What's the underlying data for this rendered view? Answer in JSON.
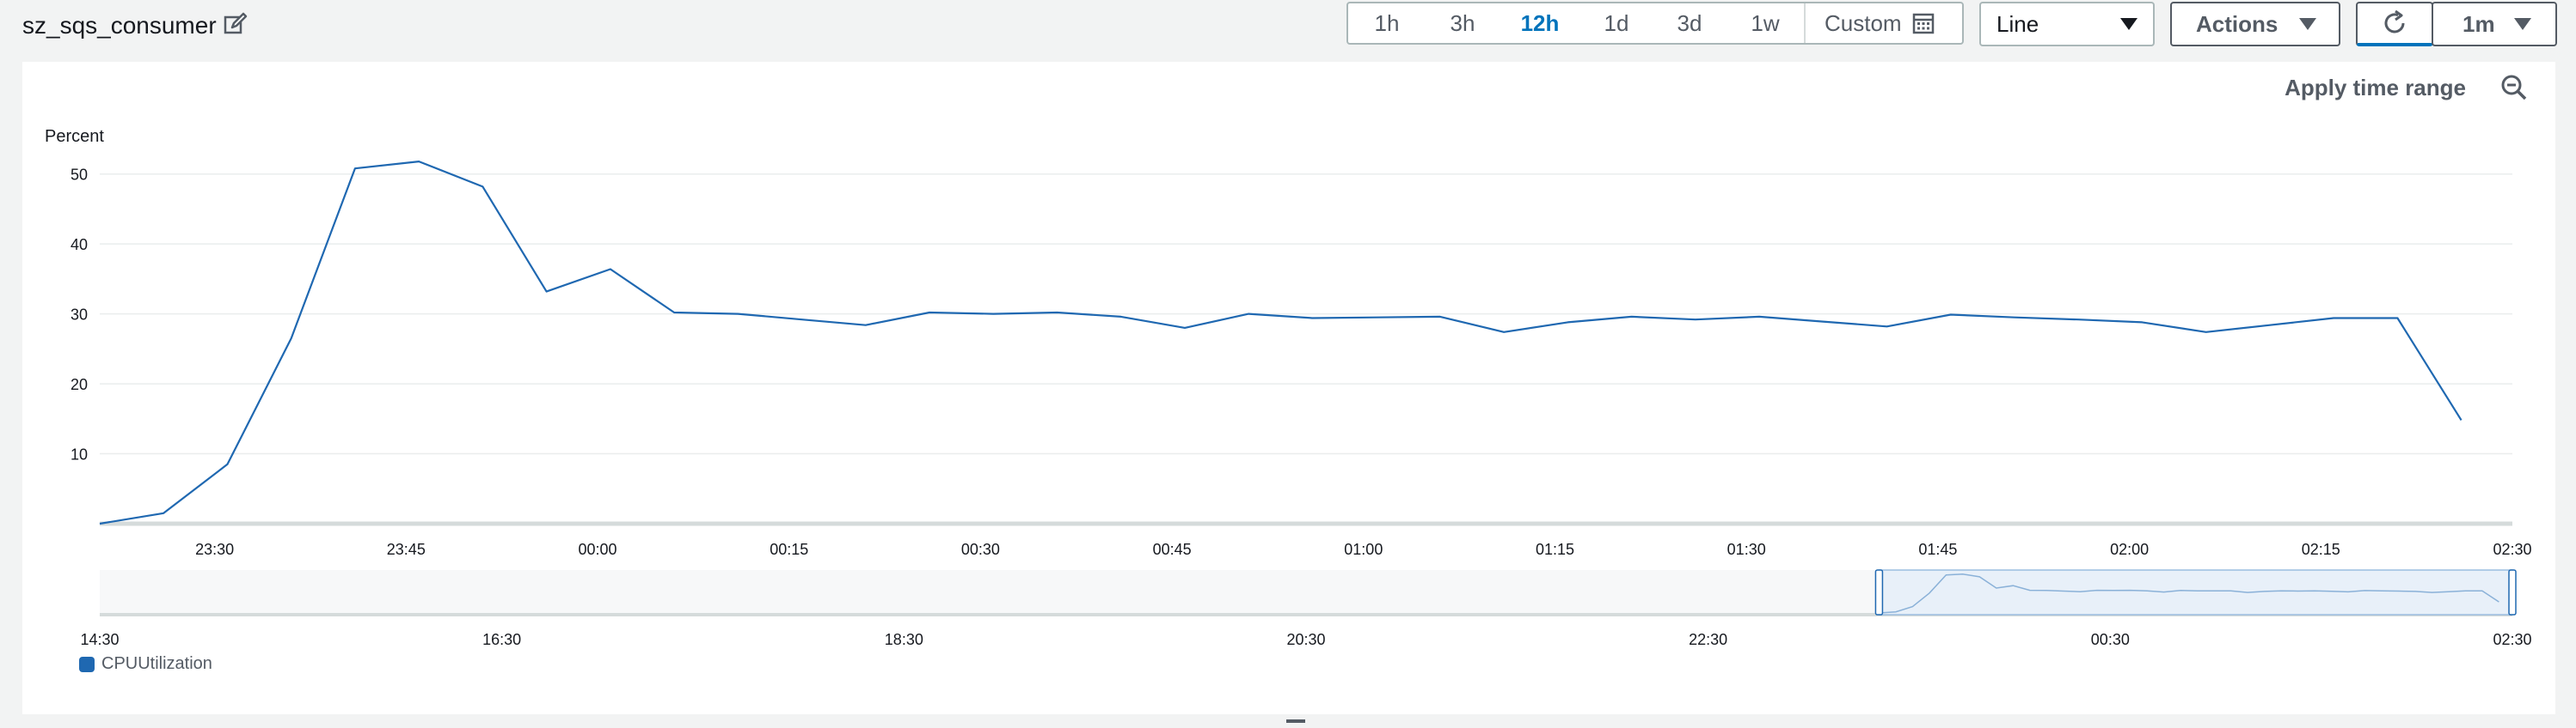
{
  "header": {
    "title": "sz_sqs_consumer",
    "ranges": [
      "1h",
      "3h",
      "12h",
      "1d",
      "3d",
      "1w"
    ],
    "active_range": "12h",
    "custom_label": "Custom",
    "view_select": "Line",
    "actions_label": "Actions",
    "interval_label": "1m"
  },
  "panel": {
    "apply_label": "Apply time range"
  },
  "colors": {
    "series": "#1f68b1",
    "active": "#0073bb"
  },
  "chart_data": {
    "type": "line",
    "ylabel": "Percent",
    "ylim": [
      0,
      55
    ],
    "yticks": [
      10,
      20,
      30,
      40,
      50
    ],
    "grid": true,
    "x_ticks": [
      "23:30",
      "23:45",
      "00:00",
      "00:15",
      "00:30",
      "00:45",
      "01:00",
      "01:15",
      "01:30",
      "01:45",
      "02:00",
      "02:15",
      "02:30"
    ],
    "series": [
      {
        "name": "CPUUtilization",
        "x": [
          "23:21",
          "23:26",
          "23:31",
          "23:36",
          "23:41",
          "23:46",
          "23:51",
          "23:56",
          "00:01",
          "00:06",
          "00:11",
          "00:16",
          "00:21",
          "00:26",
          "00:31",
          "00:36",
          "00:41",
          "00:46",
          "00:51",
          "00:56",
          "01:01",
          "01:06",
          "01:11",
          "01:16",
          "01:21",
          "01:26",
          "01:31",
          "01:36",
          "01:41",
          "01:46",
          "01:51",
          "01:56",
          "02:01",
          "02:06",
          "02:11",
          "02:16",
          "02:21",
          "02:26"
        ],
        "values": [
          0,
          1.5,
          8.5,
          26.5,
          50.8,
          51.8,
          48.2,
          33.2,
          36.4,
          30.2,
          30.0,
          29.2,
          28.4,
          30.2,
          30.0,
          30.2,
          29.6,
          28.0,
          30.0,
          29.4,
          29.5,
          29.6,
          27.4,
          28.8,
          29.6,
          29.2,
          29.6,
          28.9,
          28.2,
          29.9,
          29.5,
          29.2,
          28.8,
          27.4,
          28.4,
          29.4,
          29.4,
          14.8
        ]
      }
    ],
    "overview": {
      "x_ticks": [
        "14:30",
        "16:30",
        "18:30",
        "20:30",
        "22:30",
        "00:30",
        "02:30"
      ],
      "selection": [
        "23:21",
        "02:30"
      ]
    }
  }
}
